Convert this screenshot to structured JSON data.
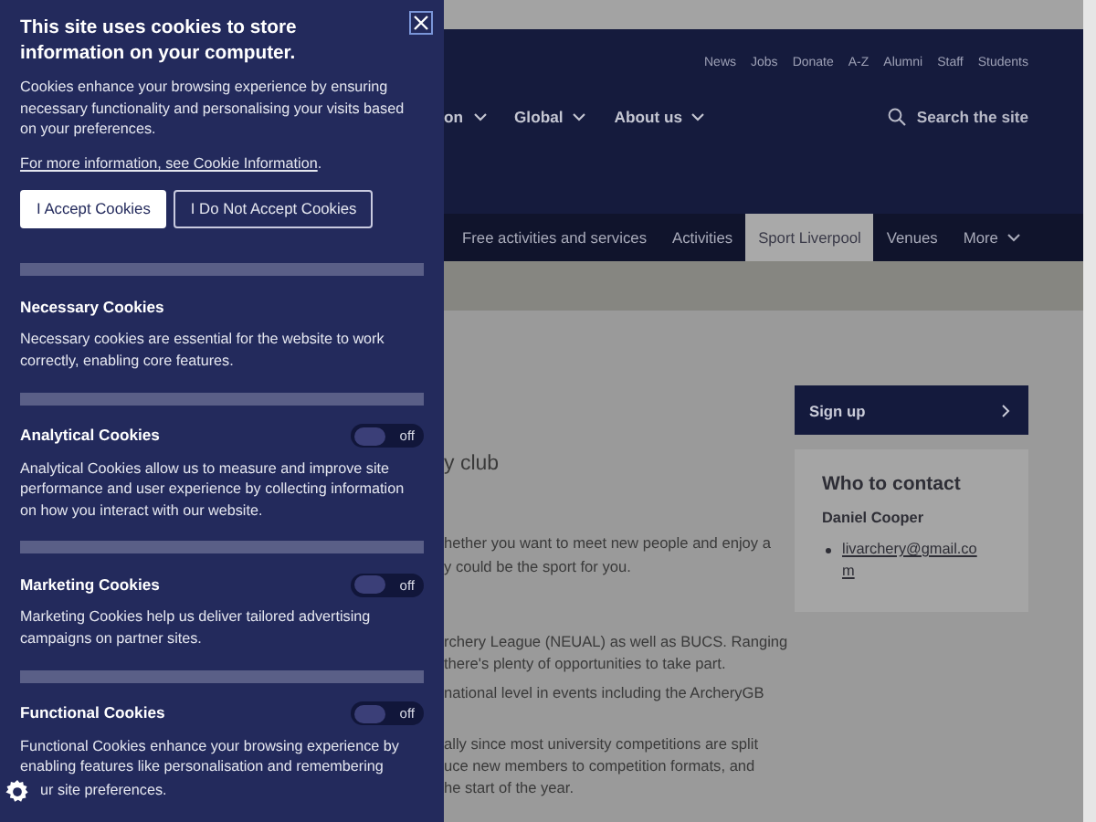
{
  "cookie_panel": {
    "title": "This site uses cookies to store information on your computer.",
    "description": "Cookies enhance your browsing experience by ensuring necessary functionality and personalising your visits based on your preferences.",
    "info_link": "For more information, see Cookie Information",
    "info_link_end": ".",
    "buttons": [
      {
        "label": "I Accept Cookies",
        "kind": "primary"
      },
      {
        "label": "I Do Not Accept Cookies",
        "kind": "secondary"
      }
    ],
    "sections": [
      {
        "title": "Necessary Cookies",
        "description": "Necessary cookies are essential for the website to work correctly, enabling core features."
      },
      {
        "title": "Analytical Cookies",
        "description": "Analytical Cookies allow us to measure and improve site performance and user experience by collecting information on how you interact with our website.",
        "toggle": {
          "on": false,
          "label": "off"
        }
      },
      {
        "title": "Marketing Cookies",
        "description": "Marketing Cookies help us deliver tailored advertising campaigns on partner sites.",
        "toggle": {
          "on": false,
          "label": "off"
        }
      },
      {
        "title": "Functional Cookies",
        "description": "Functional Cookies enhance your browsing experience by enabling features like personalisation and remembering",
        "description_tail": "ur site preferences.",
        "toggle": {
          "on": false,
          "label": "off"
        }
      }
    ]
  },
  "page": {
    "utility_links": [
      "News",
      "Jobs",
      "Donate",
      "A-Z",
      "Alumni",
      "Staff",
      "Students"
    ],
    "main_nav": [
      {
        "label": "on",
        "dropdown": true
      },
      {
        "label": "Global",
        "dropdown": true
      },
      {
        "label": "About us",
        "dropdown": true
      }
    ],
    "search": {
      "placeholder": "Search the site"
    },
    "sub_nav": [
      {
        "label": "Free activities and services",
        "selected": false,
        "dropdown": false
      },
      {
        "label": "Activities",
        "selected": false,
        "dropdown": false
      },
      {
        "label": "Sport Liverpool",
        "selected": true,
        "dropdown": false
      },
      {
        "label": "Venues",
        "selected": false,
        "dropdown": false
      },
      {
        "label": "More",
        "selected": false,
        "dropdown": true
      }
    ],
    "content": {
      "heading": "y club",
      "paragraphs": [
        [
          "hether you want to meet new people and enjoy a",
          "y could be the sport for you."
        ],
        [
          "rchery League (NEUAL) as well as BUCS. Ranging",
          "there's plenty of opportunities to take part."
        ],
        [
          "national level in events including the ArcheryGB"
        ],
        [
          "ally since most university competitions are split",
          "uce new members to competition formats, and",
          "he start of the year."
        ]
      ]
    },
    "sidebar": {
      "signup": "Sign up",
      "contact": {
        "title": "Who to contact",
        "name": "Daniel Cooper",
        "email": "livarchery@gmail.com"
      }
    }
  }
}
